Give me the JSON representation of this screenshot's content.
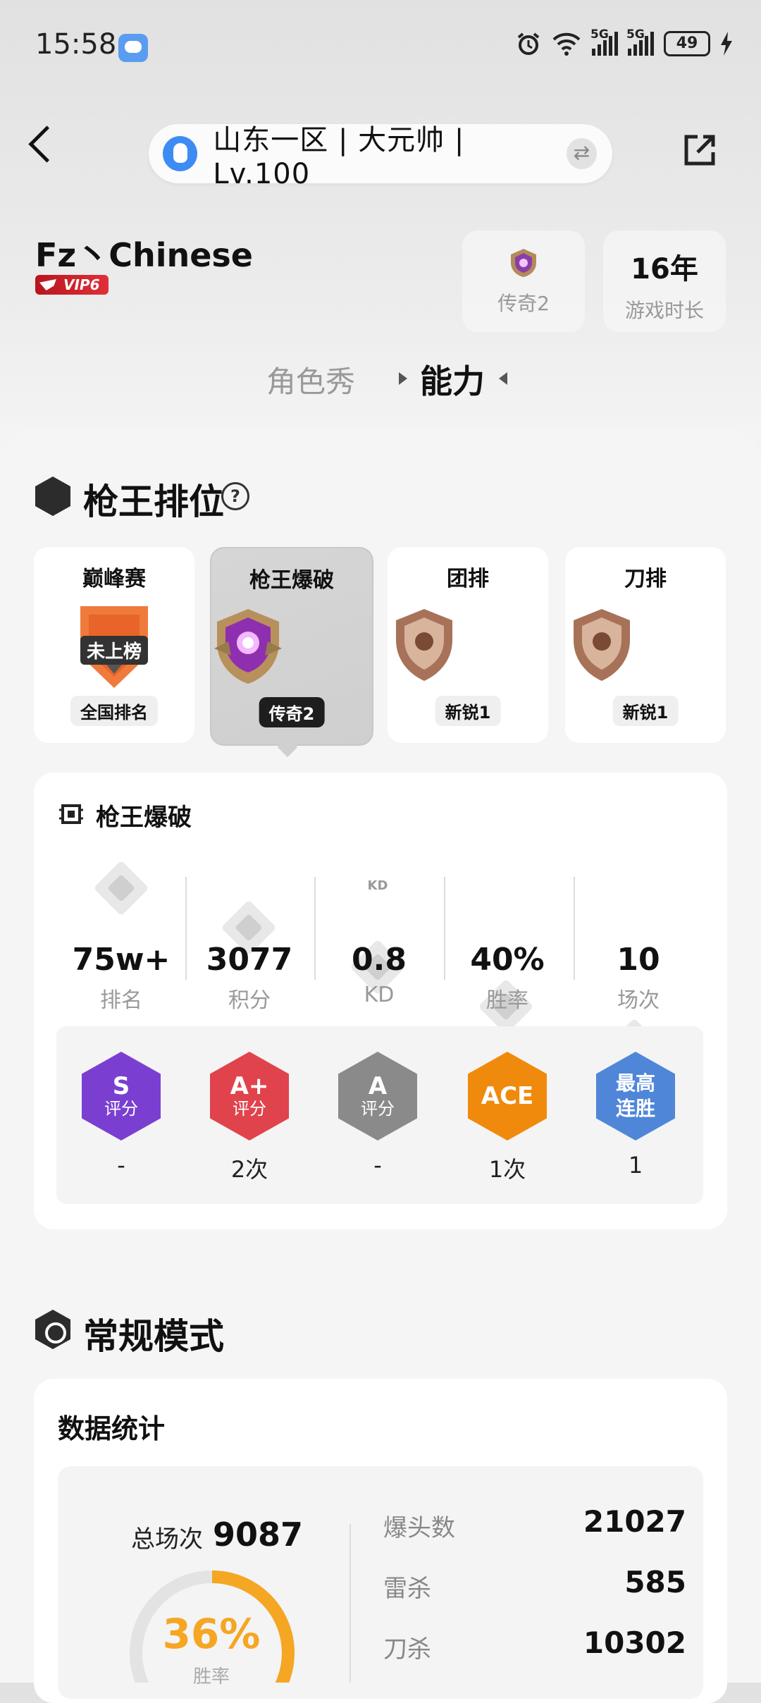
{
  "status_bar": {
    "time": "15:58",
    "network_1": "5G",
    "network_2": "5G",
    "battery": "49"
  },
  "header": {
    "server_info": "山东一区 | 大元帅 | Lv.100"
  },
  "player": {
    "name": "Fz丶Chinese",
    "vip": "VIP6",
    "rank_card": {
      "label": "传奇2"
    },
    "years_card": {
      "value": "16年",
      "label": "游戏时长"
    }
  },
  "tabs": [
    {
      "label": "角色秀"
    },
    {
      "label": "能力"
    }
  ],
  "ranked": {
    "title": "枪王排位",
    "help": "?",
    "modes": [
      {
        "title": "巅峰赛",
        "badge_text": "未上榜",
        "tag": "全国排名"
      },
      {
        "title": "枪王爆破",
        "tag": "传奇2"
      },
      {
        "title": "团排",
        "tag": "新锐1"
      },
      {
        "title": "刀排",
        "tag": "新锐1"
      }
    ],
    "detail": {
      "title": "枪王爆破",
      "stats": [
        {
          "value": "75w+",
          "label": "排名"
        },
        {
          "value": "3077",
          "label": "积分"
        },
        {
          "value": "0.8",
          "label": "KD"
        },
        {
          "value": "40%",
          "label": "胜率"
        },
        {
          "value": "10",
          "label": "场次"
        }
      ],
      "kd_icon_text": "KD",
      "badges": [
        {
          "line1": "S",
          "line2": "评分",
          "count": "-",
          "color": "#7a3fd1"
        },
        {
          "line1": "A+",
          "line2": "评分",
          "count": "2次",
          "color": "#e0434c"
        },
        {
          "line1": "A",
          "line2": "评分",
          "count": "-",
          "color": "#8a8a8a"
        },
        {
          "line1": "ACE",
          "line2": "",
          "count": "1次",
          "color": "#f08a0c"
        },
        {
          "line1": "最高",
          "line2": "连胜",
          "count": "1",
          "color": "#4f86d8"
        }
      ]
    }
  },
  "normal": {
    "title": "常规模式",
    "stats_title": "数据统计",
    "total_label": "总场次",
    "total_value": "9087",
    "win_rate": "36%",
    "win_rate_value": 36,
    "win_rate_label": "胜率",
    "rows": [
      {
        "label": "爆头数",
        "value": "21027"
      },
      {
        "label": "雷杀",
        "value": "585"
      },
      {
        "label": "刀杀",
        "value": "10302"
      }
    ]
  }
}
